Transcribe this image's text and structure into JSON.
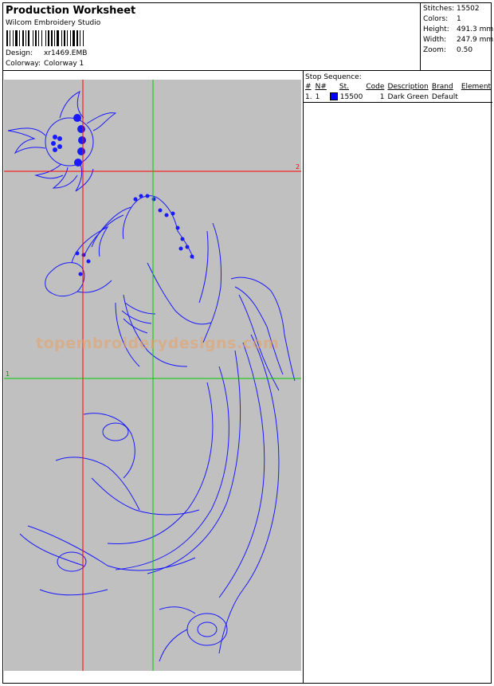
{
  "header": {
    "title": "Production Worksheet",
    "software": "Wilcom Embroidery Studio",
    "design_label": "Design:",
    "design_value": "xr1469.EMB",
    "colorway_label": "Colorway:",
    "colorway_value": "Colorway 1"
  },
  "stats": {
    "stitches_label": "Stitches:",
    "stitches_value": "15502",
    "colors_label": "Colors:",
    "colors_value": "1",
    "height_label": "Height:",
    "height_value": "491.3 mm",
    "width_label": "Width:",
    "width_value": "247.9 mm",
    "zoom_label": "Zoom:",
    "zoom_value": "0.50"
  },
  "stop_sequence": {
    "title": "Stop Sequence:",
    "columns": [
      "#",
      "N#",
      "St.",
      "Code",
      "Description",
      "Brand",
      "Element"
    ],
    "rows": [
      {
        "num": "1.",
        "n": "1",
        "color": "#0000ff",
        "st": "15500",
        "code": "1",
        "description": "Dark Green",
        "brand": "Default",
        "element": ""
      }
    ]
  },
  "canvas": {
    "guide_h_label": "2",
    "guide_v_label": "1",
    "watermark": "topembroiderydesigns.com",
    "line_color": "#1a1aff",
    "guide_red": "#ff0000",
    "guide_green": "#00cc00"
  }
}
